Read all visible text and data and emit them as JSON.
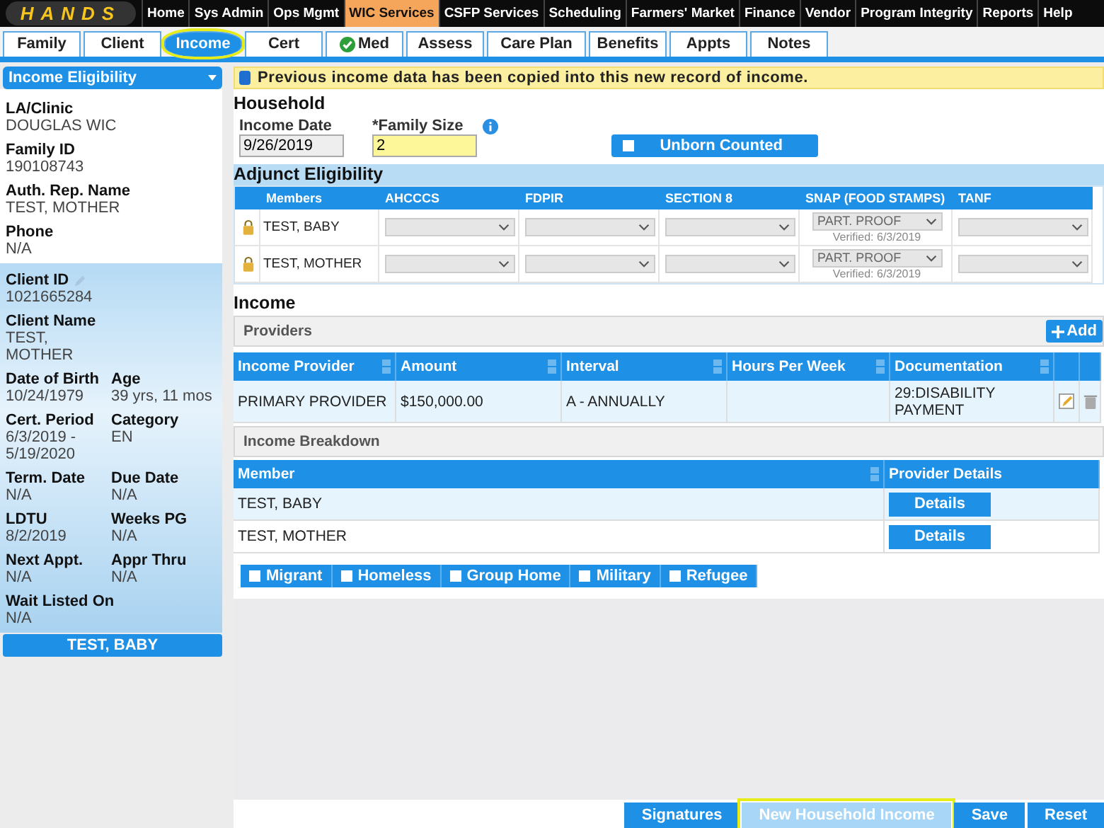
{
  "logo": "HANDS",
  "nav": [
    {
      "label": "Home",
      "selected": false
    },
    {
      "label": "Sys Admin",
      "selected": false
    },
    {
      "label": "Ops Mgmt",
      "selected": false
    },
    {
      "label": "WIC Services",
      "selected": true
    },
    {
      "label": "CSFP Services",
      "selected": false
    },
    {
      "label": "Scheduling",
      "selected": false
    },
    {
      "label": "Farmers' Market",
      "selected": false
    },
    {
      "label": "Finance",
      "selected": false
    },
    {
      "label": "Vendor",
      "selected": false
    },
    {
      "label": "Program Integrity",
      "selected": false
    },
    {
      "label": "Reports",
      "selected": false
    },
    {
      "label": "Help",
      "selected": false
    }
  ],
  "tabs": [
    {
      "label": "Family",
      "selected": false,
      "checked": false,
      "highlighted": false
    },
    {
      "label": "Client",
      "selected": false,
      "checked": false,
      "highlighted": false
    },
    {
      "label": "Income",
      "selected": true,
      "checked": false,
      "highlighted": true
    },
    {
      "label": "Cert",
      "selected": false,
      "checked": false,
      "highlighted": false
    },
    {
      "label": "Med",
      "selected": false,
      "checked": true,
      "highlighted": false
    },
    {
      "label": "Assess",
      "selected": false,
      "checked": false,
      "highlighted": false
    },
    {
      "label": "Care Plan",
      "selected": false,
      "checked": false,
      "highlighted": false
    },
    {
      "label": "Benefits",
      "selected": false,
      "checked": false,
      "highlighted": false
    },
    {
      "label": "Appts",
      "selected": false,
      "checked": false,
      "highlighted": false
    },
    {
      "label": "Notes",
      "selected": false,
      "checked": false,
      "highlighted": false
    }
  ],
  "sidebar": {
    "dropdown": "Income Eligibility",
    "family_fields": [
      {
        "label": "LA/Clinic",
        "value": "DOUGLAS WIC"
      },
      {
        "label": "Family ID",
        "value": "190108743"
      },
      {
        "label": "Auth. Rep. Name",
        "value": "TEST, MOTHER"
      },
      {
        "label": "Phone",
        "value": "N/A"
      }
    ],
    "client_id": {
      "label": "Client ID",
      "value": "1021665284",
      "editable": true
    },
    "client_rows": [
      [
        {
          "label": "Client Name",
          "value": "TEST, MOTHER"
        }
      ],
      [
        {
          "label": "Date of Birth",
          "value": "10/24/1979"
        },
        {
          "label": "Age",
          "value": "39 yrs, 11 mos"
        }
      ],
      [
        {
          "label": "Cert. Period",
          "value": "6/3/2019 - 5/19/2020"
        },
        {
          "label": "Category",
          "value": "EN"
        }
      ],
      [
        {
          "label": "Term. Date",
          "value": "N/A"
        },
        {
          "label": "Due Date",
          "value": "N/A"
        }
      ],
      [
        {
          "label": "LDTU",
          "value": "8/2/2019"
        },
        {
          "label": "Weeks PG",
          "value": "N/A"
        }
      ],
      [
        {
          "label": "Next Appt.",
          "value": "N/A"
        },
        {
          "label": "Appr Thru",
          "value": "N/A"
        }
      ],
      [
        {
          "label": "Wait Listed On",
          "value": "N/A"
        }
      ]
    ],
    "client_button": "TEST, BABY"
  },
  "banner": "Previous income data has been copied into this new record of income.",
  "household": {
    "title": "Household",
    "income_date": {
      "label": "Income Date",
      "value": "9/26/2019"
    },
    "family_size": {
      "label": "*Family Size",
      "value": "2"
    },
    "unborn_counted": {
      "label": "Unborn Counted",
      "checked": false
    }
  },
  "adjunct": {
    "title": "Adjunct Eligibility",
    "columns": [
      "Members",
      "AHCCCS",
      "FDPIR",
      "SECTION 8",
      "SNAP (FOOD STAMPS)",
      "TANF"
    ],
    "rows": [
      {
        "member": "TEST, BABY",
        "locked": true,
        "cells": [
          {
            "kind": "select"
          },
          {
            "kind": "select"
          },
          {
            "kind": "select"
          },
          {
            "kind": "select",
            "value": "PART. PROOF",
            "verified": "Verified: 6/3/2019"
          },
          {
            "kind": "select"
          }
        ]
      },
      {
        "member": "TEST, MOTHER",
        "locked": true,
        "cells": [
          {
            "kind": "select"
          },
          {
            "kind": "select"
          },
          {
            "kind": "select"
          },
          {
            "kind": "select",
            "value": "PART. PROOF",
            "verified": "Verified: 6/3/2019"
          },
          {
            "kind": "select"
          }
        ]
      }
    ]
  },
  "income": {
    "title": "Income",
    "providers_title": "Providers",
    "add_button": "Add",
    "provider_columns": [
      "Income Provider",
      "Amount",
      "Interval",
      "Hours Per Week",
      "Documentation"
    ],
    "provider_rows": [
      {
        "cells": [
          "PRIMARY PROVIDER",
          "$150,000.00",
          "A - ANNUALLY",
          "",
          "29:DISABILITY PAYMENT"
        ]
      }
    ],
    "breakdown_title": "Income Breakdown",
    "breakdown_columns": [
      "Member",
      "Provider Details"
    ],
    "breakdown_rows": [
      {
        "member": "TEST, BABY",
        "button": "Details"
      },
      {
        "member": "TEST, MOTHER",
        "button": "Details"
      }
    ],
    "flags": [
      {
        "label": "Migrant",
        "checked": false
      },
      {
        "label": "Homeless",
        "checked": false
      },
      {
        "label": "Group Home",
        "checked": false
      },
      {
        "label": "Military",
        "checked": false
      },
      {
        "label": "Refugee",
        "checked": false
      }
    ]
  },
  "footer_buttons": [
    {
      "label": "Signatures",
      "disabled": false,
      "highlighted": false
    },
    {
      "label": "New Household Income",
      "disabled": true,
      "highlighted": true
    },
    {
      "label": "Save",
      "disabled": false,
      "highlighted": false
    },
    {
      "label": "Reset",
      "disabled": false,
      "highlighted": false
    }
  ]
}
